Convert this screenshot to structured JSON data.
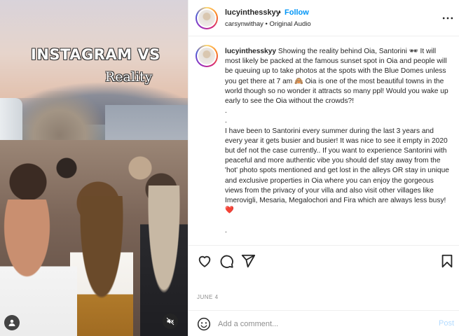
{
  "media": {
    "overlay_title": "INSTAGRAM VS",
    "overlay_subtitle": "Reality",
    "user_button_icon": "user-icon",
    "mute_button_icon": "muted-speaker-icon"
  },
  "header": {
    "username": "lucyinthesskyy",
    "separator": "•",
    "follow_label": "Follow",
    "audio_line": "carsynwithay • Original Audio",
    "more_icon": "more-horizontal-icon"
  },
  "caption": {
    "username": "lucyinthesskyy",
    "text": " Showing the reality behind Oia, Santorini 🕶 It will most likely be packed at the famous sunset spot in Oia and people will be queuing up to take photos at the spots with the Blue Domes unless you get there at 7 am 🙈 Oia is one of the most beautiful towns in the world though so no wonder it attracts so many ppl! Would you wake up early to see the Oia without the crowds?!\n.\n.\nI have been to Santorini every summer during the last 3 years and every year it gets busier and busier! It was nice to see it empty in 2020 but def not the case currently.. If you want to experience Santorini with peaceful and more authentic vibe you should def stay away from the 'hot' photo spots mentioned and get lost in the alleys OR stay in unique and exclusive properties in Oia where you can enjoy the gorgeous views from the privacy of your villa and also visit other villages like Imerovigli, Mesaria, Megalochori and Fira which are always less busy! ❤️\n\n."
  },
  "actions": {
    "like_icon": "heart-icon",
    "comment_icon": "comment-icon",
    "share_icon": "paper-plane-icon",
    "save_icon": "bookmark-icon"
  },
  "post_date": "JUNE 4",
  "comment_bar": {
    "emoji_icon": "smiley-icon",
    "placeholder": "Add a comment...",
    "post_label": "Post",
    "post_color": "#b3dbff"
  },
  "colors": {
    "link_blue": "#0095f6",
    "text": "#262626",
    "muted": "#8e8e8e"
  }
}
